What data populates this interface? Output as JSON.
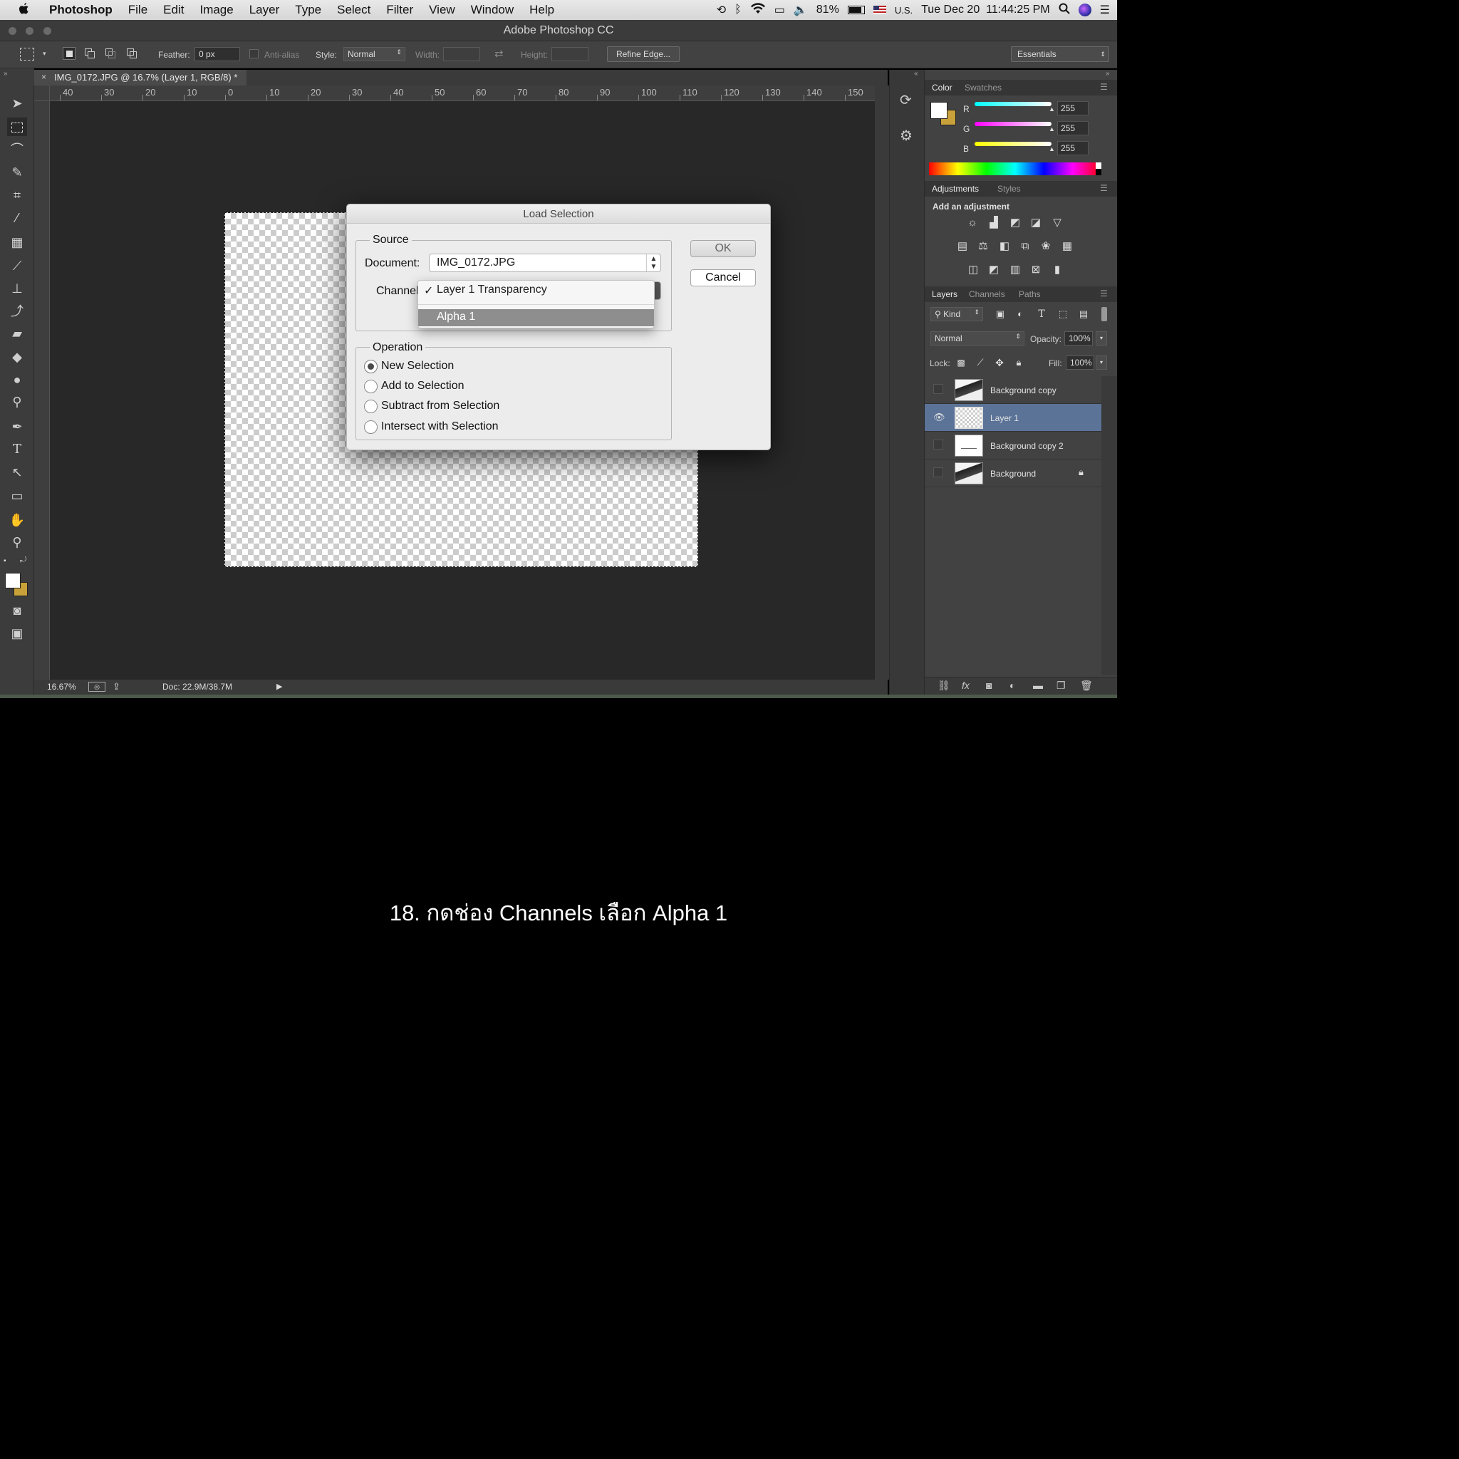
{
  "menubar": {
    "apple": "",
    "app": "Photoshop",
    "items": [
      "File",
      "Edit",
      "Image",
      "Layer",
      "Type",
      "Select",
      "Filter",
      "View",
      "Window",
      "Help"
    ],
    "battery": "81%",
    "input_source": "U.S.",
    "datetime": "Tue Dec 20  11:44:25 PM"
  },
  "window": {
    "title": "Adobe Photoshop CC"
  },
  "options": {
    "feather_label": "Feather:",
    "feather_value": "0 px",
    "antialias_label": "Anti-alias",
    "style_label": "Style:",
    "style_value": "Normal",
    "width_label": "Width:",
    "height_label": "Height:",
    "refine_edge": "Refine Edge...",
    "workspace": "Essentials"
  },
  "document": {
    "tab_title": "IMG_0172.JPG @ 16.7% (Layer 1, RGB/8) *",
    "zoom": "16.67%",
    "doc_size": "Doc: 22.9M/38.7M"
  },
  "ruler": {
    "h_ticks": [
      "40",
      "30",
      "20",
      "10",
      "0",
      "10",
      "20",
      "30",
      "40",
      "50",
      "60",
      "70",
      "80",
      "90",
      "100",
      "110",
      "120",
      "130",
      "140",
      "150"
    ]
  },
  "color_panel": {
    "tabs": [
      "Color",
      "Swatches"
    ],
    "r_label": "R",
    "r_value": "255",
    "g_label": "G",
    "g_value": "255",
    "b_label": "B",
    "b_value": "255"
  },
  "adjustments_panel": {
    "tabs": [
      "Adjustments",
      "Styles"
    ],
    "heading": "Add an adjustment"
  },
  "layers_panel": {
    "tabs": [
      "Layers",
      "Channels",
      "Paths"
    ],
    "kind": "Kind",
    "blend_mode": "Normal",
    "opacity_label": "Opacity:",
    "opacity_value": "100%",
    "lock_label": "Lock:",
    "fill_label": "Fill:",
    "fill_value": "100%",
    "layers": [
      {
        "name": "Background copy",
        "visible": false,
        "selected": false
      },
      {
        "name": "Layer 1",
        "visible": true,
        "selected": true
      },
      {
        "name": "Background copy 2",
        "visible": false,
        "selected": false
      },
      {
        "name": "Background",
        "visible": false,
        "selected": false
      }
    ]
  },
  "dialog": {
    "title": "Load Selection",
    "source_legend": "Source",
    "document_label": "Document:",
    "document_value": "IMG_0172.JPG",
    "channel_label": "Channel",
    "channel_options": [
      "Layer 1 Transparency",
      "Alpha 1"
    ],
    "channel_checked": "✓",
    "operation_legend": "Operation",
    "operations": [
      "New Selection",
      "Add to Selection",
      "Subtract from Selection",
      "Intersect with Selection"
    ],
    "ok": "OK",
    "cancel": "Cancel"
  },
  "caption": "18. กดช่อง Channels เลือก Alpha 1",
  "colors": {
    "accent_selected_layer": "#5b7397",
    "menu_highlight": "#8e8e8e",
    "bg_swatch": "#c9a13a"
  }
}
